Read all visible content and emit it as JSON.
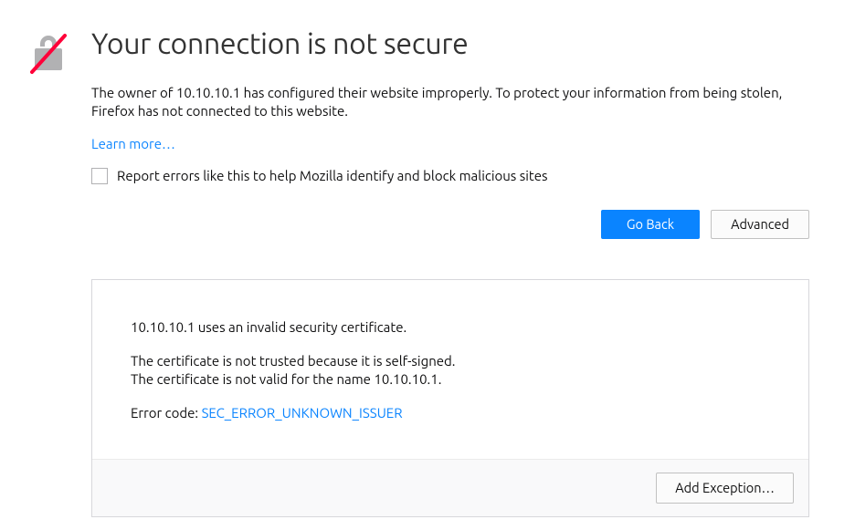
{
  "title": "Your connection is not secure",
  "description": "The owner of 10.10.10.1 has configured their website improperly. To protect your information from being stolen, Firefox has not connected to this website.",
  "learn_more_label": "Learn more…",
  "report_label": "Report errors like this to help Mozilla identify and block malicious sites",
  "buttons": {
    "go_back": "Go Back",
    "advanced": "Advanced",
    "add_exception": "Add Exception…"
  },
  "details": {
    "line1": "10.10.10.1 uses an invalid security certificate.",
    "line2": "The certificate is not trusted because it is self-signed.",
    "line3": "The certificate is not valid for the name 10.10.10.1.",
    "error_code_label": "Error code: ",
    "error_code": "SEC_ERROR_UNKNOWN_ISSUER"
  },
  "colors": {
    "link": "#0a84ff",
    "primary_btn": "#0a84ff",
    "slash": "#ff0039",
    "lock": "#b1b1b3"
  }
}
